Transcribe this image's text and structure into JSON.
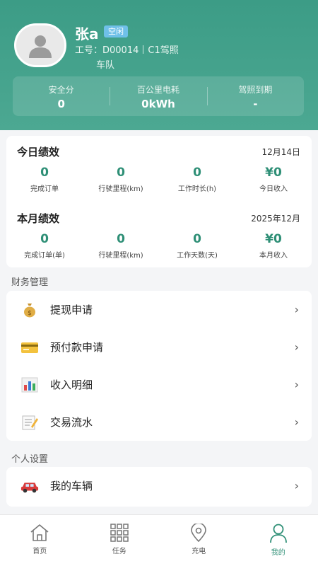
{
  "profile": {
    "name": "张a",
    "status_badge": "空闲",
    "work_id": "工号：D00014",
    "license": "C1驾照",
    "team": "车队"
  },
  "stats": [
    {
      "label": "安全分",
      "value": "0"
    },
    {
      "label": "百公里电耗",
      "value": "0kWh"
    },
    {
      "label": "驾照到期",
      "value": "-"
    }
  ],
  "today": {
    "title": "今日绩效",
    "date": "12月14日",
    "items": [
      {
        "value": "0",
        "label": "完成订单"
      },
      {
        "value": "0",
        "label": "行驶里程(km)"
      },
      {
        "value": "0",
        "label": "工作时长(h)"
      },
      {
        "value": "¥0",
        "label": "今日收入"
      }
    ]
  },
  "month": {
    "title": "本月绩效",
    "date": "2025年12月",
    "items": [
      {
        "value": "0",
        "label": "完成订单(单)"
      },
      {
        "value": "0",
        "label": "行驶里程(km)"
      },
      {
        "value": "0",
        "label": "工作天数(天)"
      },
      {
        "value": "¥0",
        "label": "本月收入"
      }
    ]
  },
  "finance": {
    "section": "财务管理",
    "items": [
      {
        "label": "提现申请",
        "icon": "money-bag-icon"
      },
      {
        "label": "预付款申请",
        "icon": "credit-card-icon"
      },
      {
        "label": "收入明细",
        "icon": "bar-chart-icon"
      },
      {
        "label": "交易流水",
        "icon": "memo-icon"
      }
    ]
  },
  "personal": {
    "section": "个人设置",
    "items": [
      {
        "label": "我的车辆",
        "icon": "car-icon"
      }
    ]
  },
  "tabs": [
    {
      "label": "首页",
      "icon": "home-icon"
    },
    {
      "label": "任务",
      "icon": "grid-icon"
    },
    {
      "label": "充电",
      "icon": "location-pin-icon"
    },
    {
      "label": "我的",
      "icon": "user-icon"
    }
  ],
  "colors": {
    "accent": "#2e8f76",
    "header": "#3c9c86",
    "badge": "#6fc0e8"
  }
}
